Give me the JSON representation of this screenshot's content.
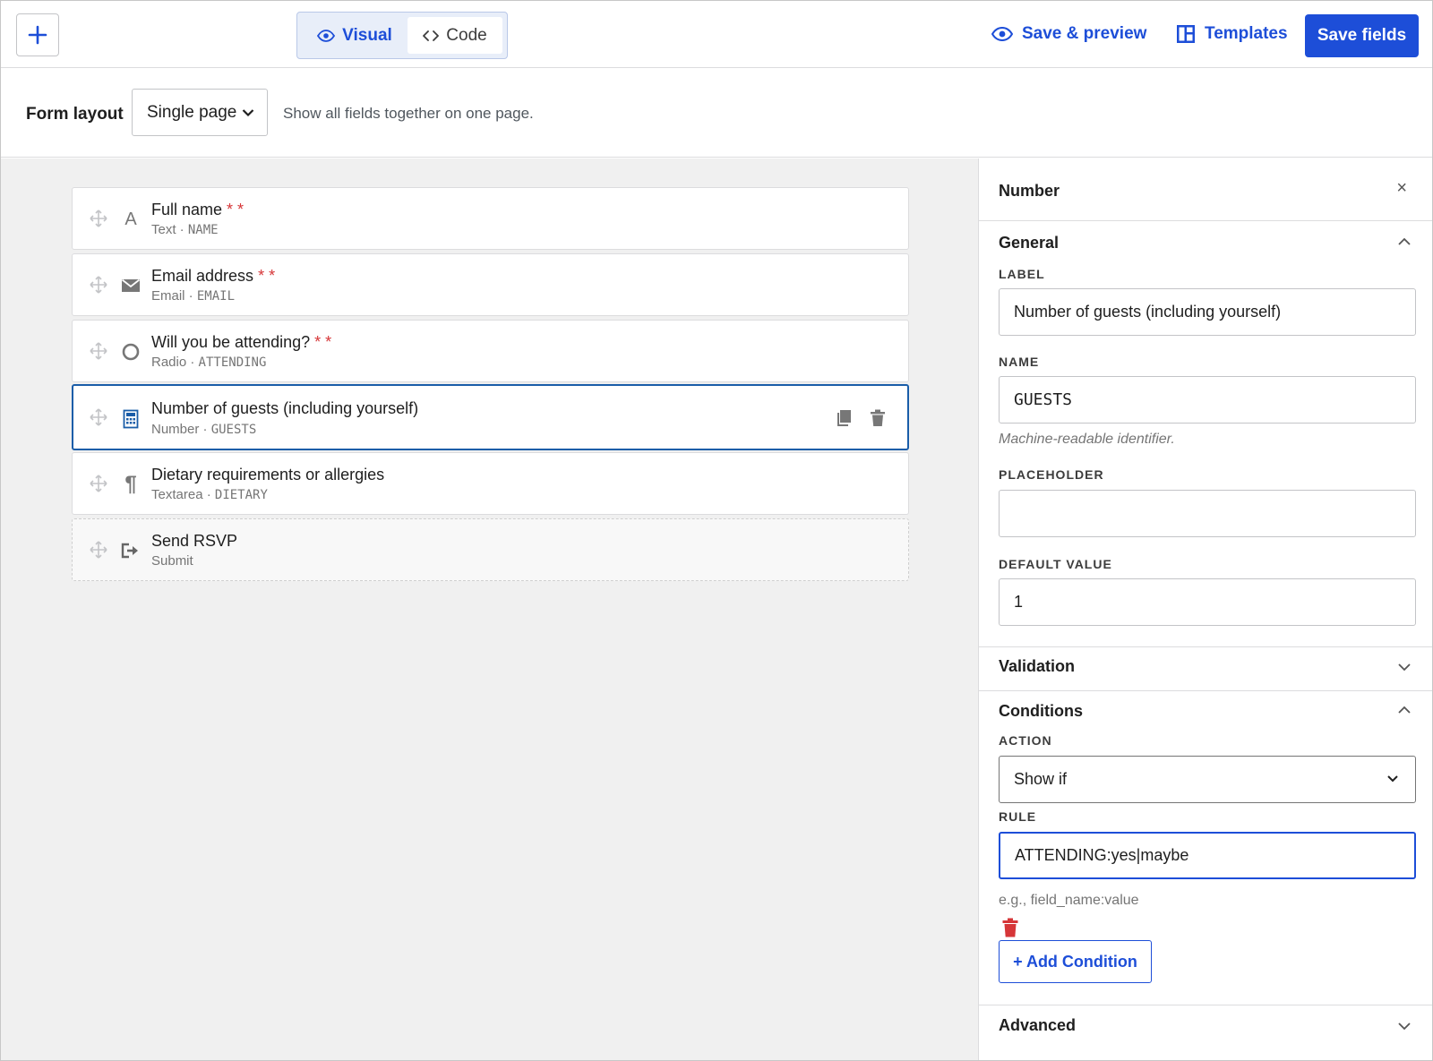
{
  "toolbar": {
    "add_label": "+",
    "view_tabs": {
      "visual": "Visual",
      "code": "Code",
      "active": "Visual"
    },
    "save_preview": "Save & preview",
    "templates": "Templates",
    "save_fields": "Save fields",
    "accent_color": "#1d4ed8"
  },
  "layout": {
    "label": "Form layout",
    "selected": "Single page",
    "help": "Show all fields together on one page."
  },
  "fields": [
    {
      "title": "Full name",
      "required_marker": "* *",
      "type": "Text",
      "name": "NAME",
      "icon": "text-icon"
    },
    {
      "title": "Email address",
      "required_marker": "* *",
      "type": "Email",
      "name": "EMAIL",
      "icon": "envelope-icon"
    },
    {
      "title": "Will you be attending?",
      "required_marker": "* *",
      "type": "Radio",
      "name": "ATTENDING",
      "icon": "radio-icon"
    },
    {
      "title": "Number of guests (including yourself)",
      "required_marker": "",
      "type": "Number",
      "name": "GUESTS",
      "icon": "calculator-icon",
      "selected": true
    },
    {
      "title": "Dietary requirements or allergies",
      "required_marker": "",
      "type": "Textarea",
      "name": "DIETARY",
      "icon": "paragraph-icon"
    },
    {
      "title": "Send RSVP",
      "required_marker": "",
      "type": "Submit",
      "name": "",
      "icon": "submit-icon"
    }
  ],
  "panel": {
    "title": "Number",
    "close": "×",
    "general": {
      "heading": "General",
      "label_label": "LABEL",
      "label_value": "Number of guests (including yourself)",
      "name_label": "NAME",
      "name_value": "GUESTS",
      "name_hint": "Machine-readable identifier.",
      "placeholder_label": "PLACEHOLDER",
      "placeholder_value": "",
      "default_label": "DEFAULT VALUE",
      "default_value": "1"
    },
    "validation": {
      "heading": "Validation"
    },
    "conditions": {
      "heading": "Conditions",
      "action_label": "ACTION",
      "action_value": "Show if",
      "rule_label": "RULE",
      "rule_value": "ATTENDING:yes|maybe",
      "rule_hint": "e.g., field_name:value",
      "add_button": "+ Add Condition"
    },
    "advanced": {
      "heading": "Advanced"
    }
  }
}
